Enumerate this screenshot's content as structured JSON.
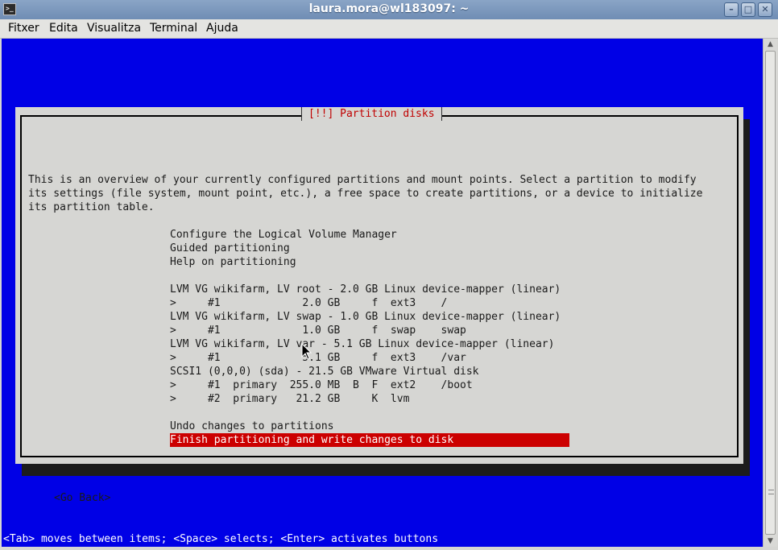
{
  "window": {
    "title": "laura.mora@wl183097: ~",
    "icon": "terminal-icon",
    "buttons": {
      "minimize": "minimize-icon",
      "maximize": "maximize-icon",
      "close": "close-icon"
    }
  },
  "menubar": [
    "Fitxer",
    "Edita",
    "Visualitza",
    "Terminal",
    "Ajuda"
  ],
  "dialog": {
    "title": "[!!] Partition disks",
    "intro": [
      "This is an overview of your currently configured partitions and mount points. Select a partition to modify",
      "its settings (file system, mount point, etc.), a free space to create partitions, or a device to initialize",
      "its partition table."
    ],
    "options": [
      "Configure the Logical Volume Manager",
      "Guided partitioning",
      "Help on partitioning",
      "",
      "LVM VG wikifarm, LV root - 2.0 GB Linux device-mapper (linear)",
      ">     #1             2.0 GB     f  ext3    /",
      "LVM VG wikifarm, LV swap - 1.0 GB Linux device-mapper (linear)",
      ">     #1             1.0 GB     f  swap    swap",
      "LVM VG wikifarm, LV var - 5.1 GB Linux device-mapper (linear)",
      ">     #1             5.1 GB     f  ext3    /var",
      "SCSI1 (0,0,0) (sda) - 21.5 GB VMware Virtual disk",
      ">     #1  primary  255.0 MB  B  F  ext2    /boot",
      ">     #2  primary   21.2 GB     K  lvm",
      "",
      "Undo changes to partitions",
      "Finish partitioning and write changes to disk"
    ],
    "selected_option": "Finish partitioning and write changes to disk",
    "go_back": "<Go Back>"
  },
  "status_line": "<Tab> moves between items; <Space> selects; <Enter> activates buttons",
  "colors": {
    "terminal_background": "#0000e6",
    "dialog_background": "#d6d6d3",
    "title_text": "#c00000",
    "selection_background": "#cc0000"
  }
}
